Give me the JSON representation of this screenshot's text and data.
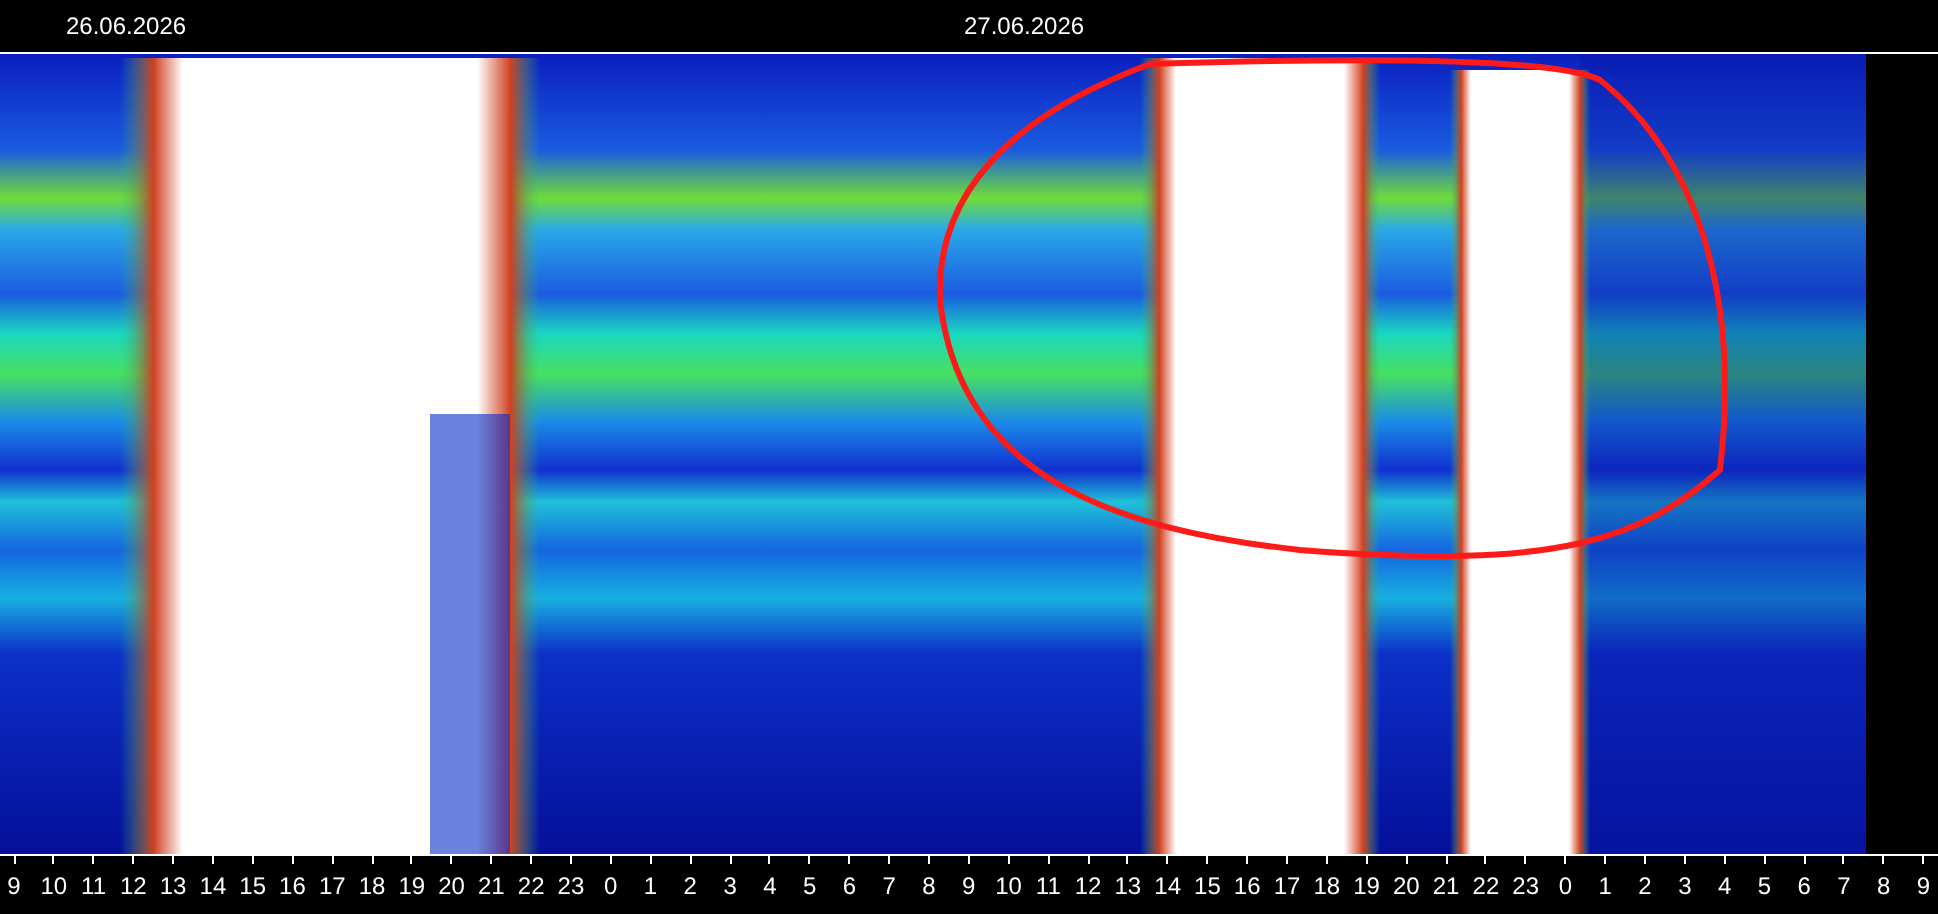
{
  "dates": [
    {
      "label": "26.06.2026"
    },
    {
      "label": "27.06.2026"
    }
  ],
  "hour_labels": [
    "9",
    "10",
    "11",
    "12",
    "13",
    "14",
    "15",
    "16",
    "17",
    "18",
    "19",
    "20",
    "21",
    "22",
    "23",
    "0",
    "1",
    "2",
    "3",
    "4",
    "5",
    "6",
    "7",
    "8",
    "9",
    "10",
    "11",
    "12",
    "13",
    "14",
    "15",
    "16",
    "17",
    "18",
    "19",
    "20",
    "21",
    "22",
    "23",
    "0",
    "1",
    "2",
    "3",
    "4",
    "5",
    "6",
    "7",
    "8",
    "9"
  ]
}
